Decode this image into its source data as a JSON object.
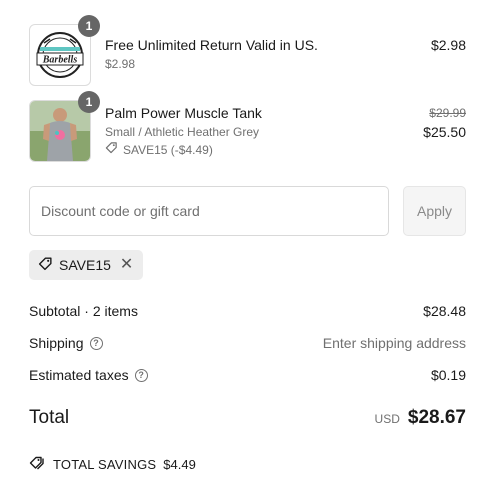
{
  "items": [
    {
      "quantity": "1",
      "title": "Free Unlimited Return Valid in US.",
      "subtitle": "$2.98",
      "price": "$2.98",
      "thumb_text": "Barbells"
    },
    {
      "quantity": "1",
      "title": "Palm Power Muscle Tank",
      "subtitle": "Small / Athletic Heather Grey",
      "discount": "SAVE15 (-$4.49)",
      "original_price": "$29.99",
      "price": "$25.50"
    }
  ],
  "discount": {
    "placeholder": "Discount code or gift card",
    "apply_label": "Apply",
    "applied_code": "SAVE15"
  },
  "summary": {
    "subtotal_label": "Subtotal · 2 items",
    "subtotal_value": "$28.48",
    "shipping_label": "Shipping",
    "shipping_value": "Enter shipping address",
    "taxes_label": "Estimated taxes",
    "taxes_value": "$0.19",
    "total_label": "Total",
    "currency": "USD",
    "total_value": "$28.67",
    "savings_label": "TOTAL SAVINGS",
    "savings_value": "$4.49"
  },
  "colors": {
    "text": "#1a1a1a",
    "muted": "#707070",
    "badge": "#666666",
    "chip": "#ededed"
  }
}
